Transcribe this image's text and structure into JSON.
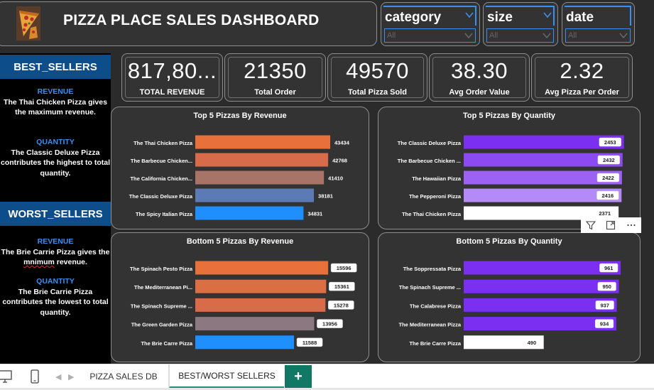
{
  "header": {
    "title": "PIZZA PLACE SALES DASHBOARD",
    "logo_icon": "pizza-slice-icon"
  },
  "filters": [
    {
      "title": "category",
      "value": "All"
    },
    {
      "title": "size",
      "value": "All"
    },
    {
      "title": "date",
      "value": "All"
    }
  ],
  "best_sellers": {
    "heading": "BEST_SELLERS",
    "revenue_label": "REVENUE",
    "revenue_text": "The Thai Chicken Pizza gives the maximum revenue.",
    "quantity_label": "QUANTITY",
    "quantity_text": "The Classic Deluxe Pizza contributes the highest to total quantity."
  },
  "worst_sellers": {
    "heading": "WORST_SELLERS",
    "revenue_label": "REVENUE",
    "revenue_text_a": "The Brie Carrie Pizza gives the ",
    "revenue_text_b": "mnimum",
    "revenue_text_c": " revenue.",
    "quantity_label": "QUANTITY",
    "quantity_text": "The Brie Carrie Pizza contributes the lowest to total quantity."
  },
  "kpis": [
    {
      "value": "817,80...",
      "label": "TOTAL REVENUE"
    },
    {
      "value": "21350",
      "label": "Total Order"
    },
    {
      "value": "49570",
      "label": "Total Pizza Sold"
    },
    {
      "value": "38.30",
      "label": "Avg Order Value"
    },
    {
      "value": "2.32",
      "label": "Avg Pizza Per Order"
    }
  ],
  "toolbar": {
    "icons": [
      "filter-icon",
      "focus-mode-icon",
      "more-options-icon"
    ]
  },
  "tabs": {
    "page1": "PIZZA SALES DB",
    "page2": "BEST/WORST SELLERS",
    "add": "+"
  },
  "chart_data": [
    {
      "type": "bar",
      "orientation": "horizontal",
      "title": "Top 5 Pizzas By Revenue",
      "categories": [
        "The Thai Chicken Pizza",
        "The Barbecue Chicken...",
        "The California Chicken...",
        "The Classic Deluxe Pizza",
        "The Spicy Italian Pizza"
      ],
      "values": [
        43434,
        42768,
        41410,
        38181,
        34831
      ],
      "labels": [
        "43434",
        "42768",
        "41410",
        "38181",
        "34831"
      ],
      "colors": [
        "#e8703a",
        "#d86b4a",
        "#a87468",
        "#5c7ab5",
        "#1e8ffc"
      ],
      "label_style": "plain",
      "xlim": [
        0,
        48000
      ]
    },
    {
      "type": "bar",
      "orientation": "horizontal",
      "title": "Top 5 Pizzas By Quantity",
      "categories": [
        "The Classic Deluxe Pizza",
        "The Barbecue Chicken ...",
        "The Hawaiian Pizza",
        "The Pepperoni Pizza",
        "The Thai Chicken Pizza"
      ],
      "values": [
        2453,
        2432,
        2422,
        2416,
        2371
      ],
      "labels": [
        "2453",
        "2432",
        "2422",
        "2416",
        "2371"
      ],
      "colors": [
        "#7b2ff0",
        "#8b4af2",
        "#9d62f4",
        "#b48af6",
        "#ffffff"
      ],
      "label_style": "boxed-inside",
      "xlim": [
        0,
        2500
      ]
    },
    {
      "type": "bar",
      "orientation": "horizontal",
      "title": "Bottom 5 Pizzas By Revenue",
      "categories": [
        "The Spinach Pesto Pizza",
        "The Mediterranean Pi...",
        "The Spinach Supreme ...",
        "The Green Garden Pizza",
        "The Brie Carre Pizza"
      ],
      "values": [
        15596,
        15361,
        15278,
        13956,
        11588
      ],
      "labels": [
        "15596",
        "15361",
        "15278",
        "13956",
        "11588"
      ],
      "colors": [
        "#e8703a",
        "#dc6e44",
        "#d86b4a",
        "#8c7880",
        "#1e8ffc"
      ],
      "label_style": "boxed",
      "xlim": [
        0,
        17500
      ]
    },
    {
      "type": "bar",
      "orientation": "horizontal",
      "title": "Bottom 5 Pizzas By Quantity",
      "categories": [
        "The Soppressata Pizza",
        "The Spinach Supreme ...",
        "The Calabrese Pizza",
        "The Mediterranean Pizza",
        "The Brie Carre Pizza"
      ],
      "values": [
        961,
        950,
        937,
        934,
        490
      ],
      "labels": [
        "961",
        "950",
        "937",
        "934",
        "490"
      ],
      "colors": [
        "#7b2ff0",
        "#7b2ff0",
        "#7b2ff0",
        "#7b2ff0",
        "#ffffff"
      ],
      "label_style": "boxed-inside",
      "xlim": [
        0,
        1000
      ]
    }
  ]
}
